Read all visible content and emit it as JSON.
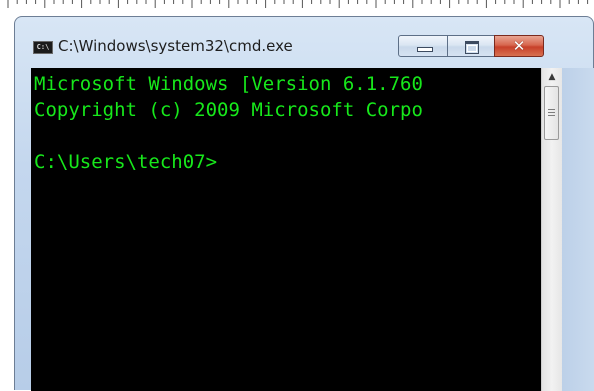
{
  "window": {
    "title": "C:\\Windows\\system32\\cmd.exe",
    "app_icon_text": "C:\\",
    "buttons": {
      "minimize_icon": "minimize-icon",
      "maximize_icon": "maximize-icon",
      "close_icon": "close-icon",
      "close_glyph": "✕"
    }
  },
  "console": {
    "lines": [
      "Microsoft Windows [Version 6.1.760",
      "Copyright (c) 2009 Microsoft Corpo",
      "",
      "C:\\Users\\tech07>"
    ],
    "text_color": "#17e81b",
    "background_color": "#000000"
  },
  "scrollbar": {
    "up_arrow": "▲"
  }
}
